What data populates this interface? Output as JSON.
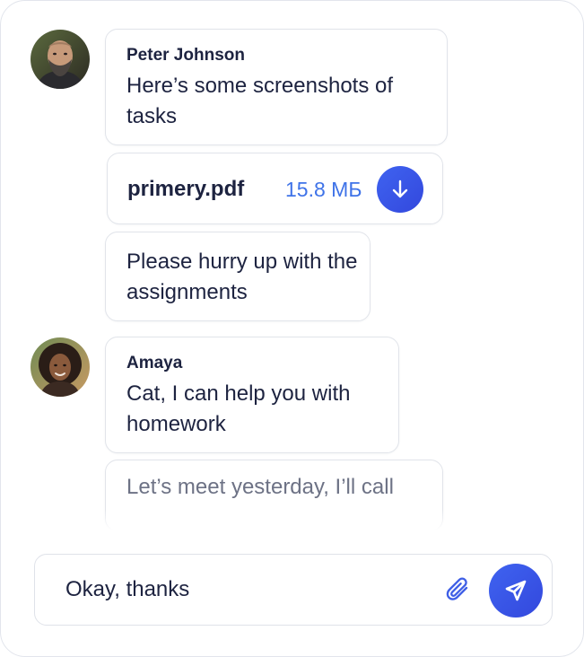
{
  "messages": [
    {
      "sender": "Peter Johnson",
      "avatar": "avatar-peter",
      "text": "Here’s some screenshots of tasks"
    },
    {
      "file": {
        "name": "primery.pdf",
        "size": "15.8 МБ",
        "icon": "download-arrow-icon"
      }
    },
    {
      "text": "Please hurry up with the assignments"
    },
    {
      "sender": "Amaya",
      "avatar": "avatar-amaya",
      "text": "Cat, I can help you with homework"
    },
    {
      "text": "Let’s meet yesterday, I’ll call"
    }
  ],
  "composer": {
    "value": "Okay, thanks",
    "attach_icon": "paperclip-icon",
    "send_icon": "send-icon"
  },
  "colors": {
    "accent": "#3f63f0",
    "accent_text": "#3f73e8",
    "text": "#1d2340",
    "muted_text": "#6d7285",
    "border": "#e1e4ea"
  }
}
